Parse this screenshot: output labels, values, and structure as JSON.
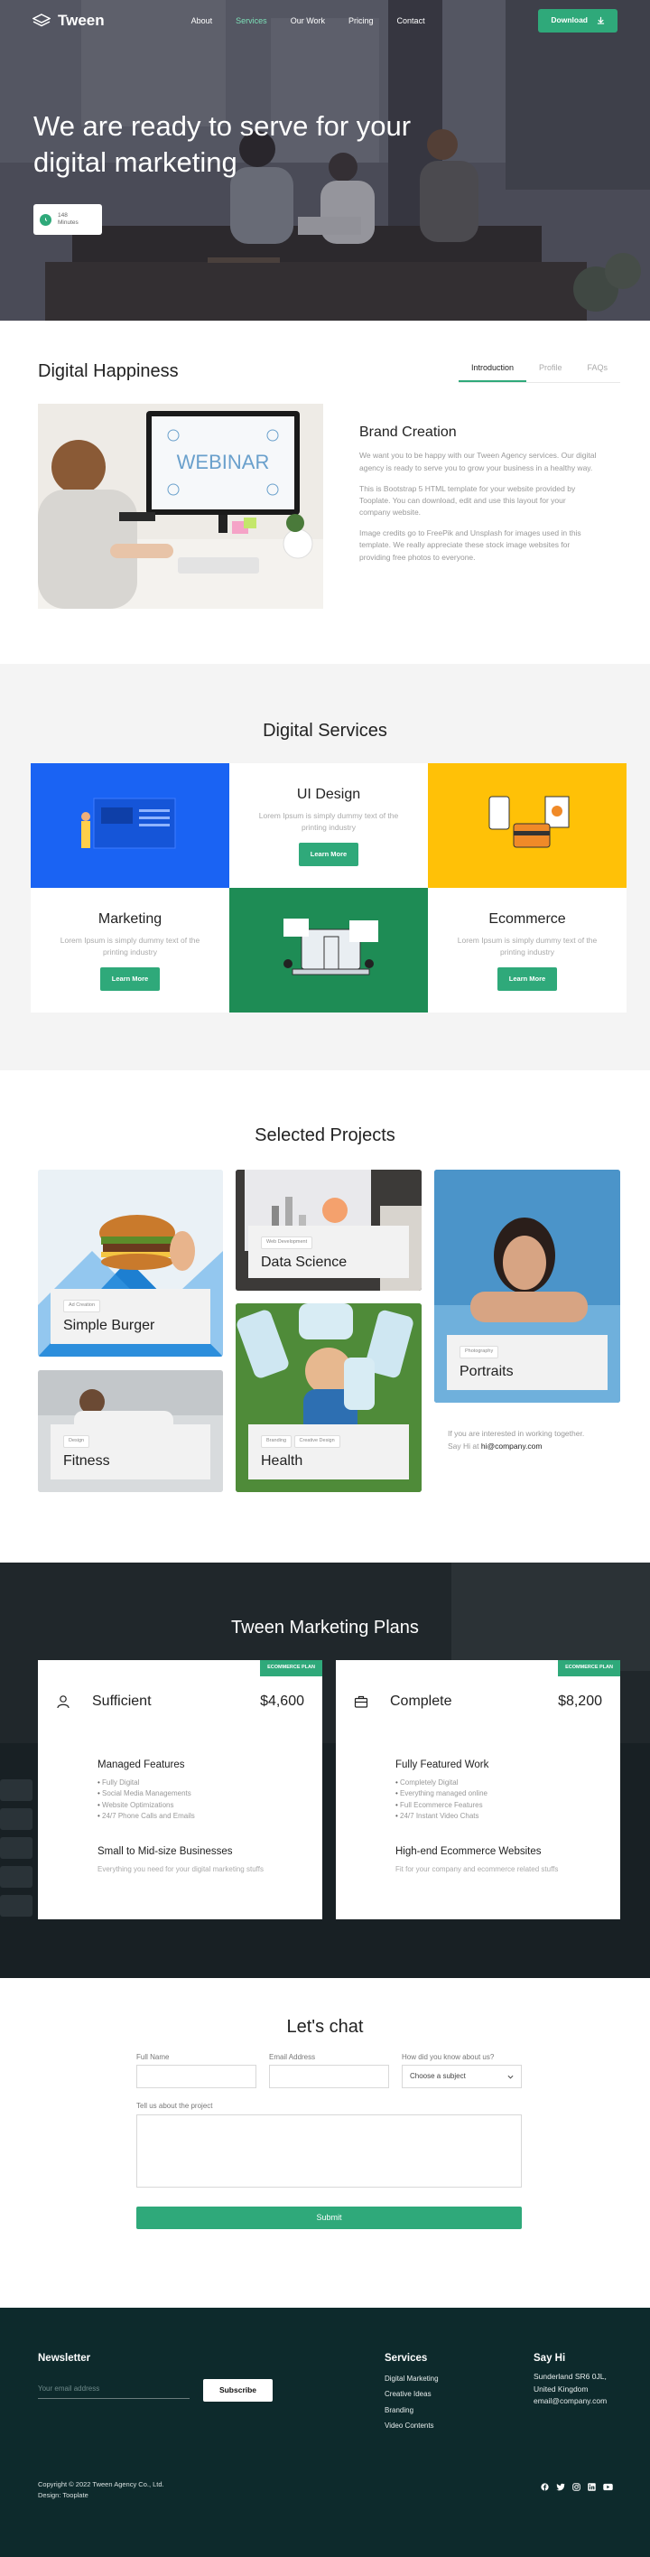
{
  "nav": {
    "brand": "Tween",
    "items": [
      "About",
      "Services",
      "Our Work",
      "Pricing",
      "Contact"
    ],
    "active_index": 1,
    "download_label": "Download"
  },
  "hero": {
    "title": "We are ready to serve for your digital marketing",
    "badge_value": "148",
    "badge_unit": "Minutes"
  },
  "happiness": {
    "title": "Digital Happiness",
    "tabs": [
      "Introduction",
      "Profile",
      "FAQs"
    ],
    "active_tab": 0,
    "image_text": "WEBINAR",
    "heading": "Brand Creation",
    "paragraphs": [
      "We want you to be happy with our Tween Agency services. Our digital agency is ready to serve you to grow your business in a healthy way.",
      "This is Bootstrap 5 HTML template for your website provided by Tooplate. You can download, edit and use this layout for your company website.",
      "Image credits go to FreePik and Unsplash for images used in this template. We really appreciate these stock image websites for providing free photos to everyone."
    ]
  },
  "services": {
    "title": "Digital Services",
    "cards": [
      {
        "title": "UI Design",
        "text": "Lorem Ipsum is simply dummy text of the printing industry",
        "button": "Learn More"
      },
      {
        "title": "Marketing",
        "text": "Lorem Ipsum is simply dummy text of the printing industry",
        "button": "Learn More"
      },
      {
        "title": "Ecommerce",
        "text": "Lorem Ipsum is simply dummy text of the printing industry",
        "button": "Learn More"
      }
    ],
    "colors": {
      "blue": "#1a63f3",
      "yellow": "#ffc107",
      "green": "#1e8c55"
    }
  },
  "projects": {
    "title": "Selected Projects",
    "items": [
      {
        "tag": "Ad Creation",
        "name": "Simple Burger"
      },
      {
        "tag": "Web Development",
        "name": "Data Science"
      },
      {
        "tag": "Photography",
        "name": "Portraits"
      },
      {
        "tag": "Design",
        "name": "Fitness"
      },
      {
        "tag": "Branding",
        "tag2": "Creative Design",
        "name": "Health"
      }
    ],
    "note": "If you are interested in working together.",
    "note2_prefix": "Say Hi at",
    "note_email": "hi@company.com"
  },
  "plans": {
    "title": "Tween Marketing Plans",
    "items": [
      {
        "ribbon": "ECOMMERCE PLAN",
        "name": "Sufficient",
        "price": "$4,600",
        "features_title": "Managed Features",
        "features": [
          "Fully Digital",
          "Social Media Managements",
          "Website Optimizations",
          "24/7 Phone Calls and Emails"
        ],
        "target_title": "Small to Mid-size Businesses",
        "target_text": "Everything you need for your digital marketing stuffs"
      },
      {
        "ribbon": "ECOMMERCE PLAN",
        "name": "Complete",
        "price": "$8,200",
        "features_title": "Fully Featured Work",
        "features": [
          "Completely Digital",
          "Everything managed online",
          "Full Ecommerce Features",
          "24/7 Instant Video Chats"
        ],
        "target_title": "High-end Ecommerce Websites",
        "target_text": "Fit for your company and ecommerce related stuffs"
      }
    ]
  },
  "chat": {
    "title": "Let's chat",
    "full_name_label": "Full Name",
    "email_label": "Email Address",
    "subject_label": "How did you know about us?",
    "subject_value": "Choose a subject",
    "message_label": "Tell us about the project",
    "submit": "Submit"
  },
  "footer": {
    "newsletter_title": "Newsletter",
    "email_placeholder": "Your email address",
    "subscribe": "Subscribe",
    "services_title": "Services",
    "services": [
      "Digital Marketing",
      "Creative Ideas",
      "Branding",
      "Video Contents"
    ],
    "sayhi_title": "Say Hi",
    "address_line1": "Sunderland SR6 0JL,",
    "address_line2": "United Kingdom",
    "email": "email@company.com",
    "copyright": "Copyright © 2022 Tween Agency Co., Ltd.",
    "design": "Design: Tooplate",
    "social_icons": [
      "facebook-icon",
      "twitter-icon",
      "instagram-icon",
      "linkedin-icon",
      "youtube-icon"
    ]
  }
}
